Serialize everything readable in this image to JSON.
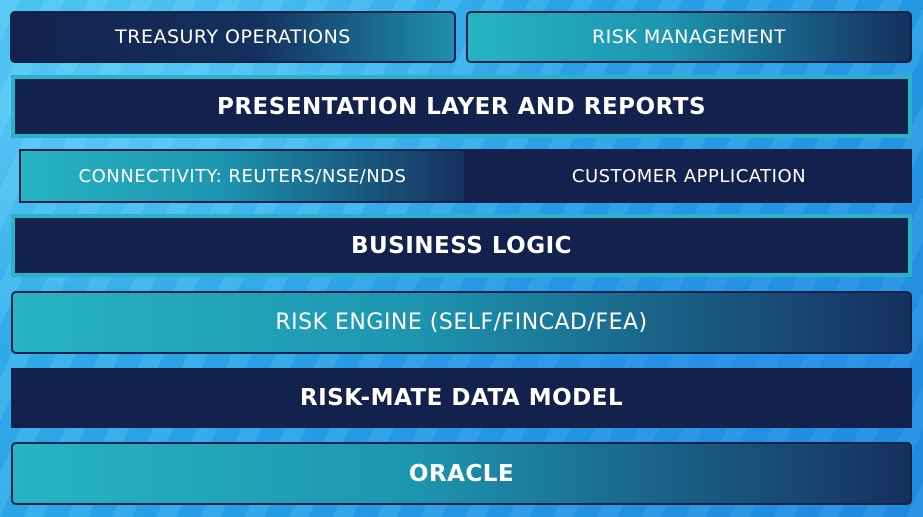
{
  "top_row": {
    "left": "TREASURY OPERATIONS",
    "right": "RISK MANAGEMENT"
  },
  "presentation": "PRESENTATION LAYER AND REPORTS",
  "middle_row": {
    "left": "CONNECTIVITY: REUTERS/NSE/NDS",
    "right": "CUSTOMER APPLICATION"
  },
  "business_logic": "BUSINESS LOGIC",
  "risk_engine": "RISK ENGINE (SELF/FINCAD/FEA)",
  "data_model": "RISK-MATE DATA MODEL",
  "database": "ORACLE",
  "colors": {
    "dark_block": "#13224d",
    "teal_block": "#27b4c2",
    "border": "#2ab2c8",
    "background": "#2aa6ea"
  }
}
